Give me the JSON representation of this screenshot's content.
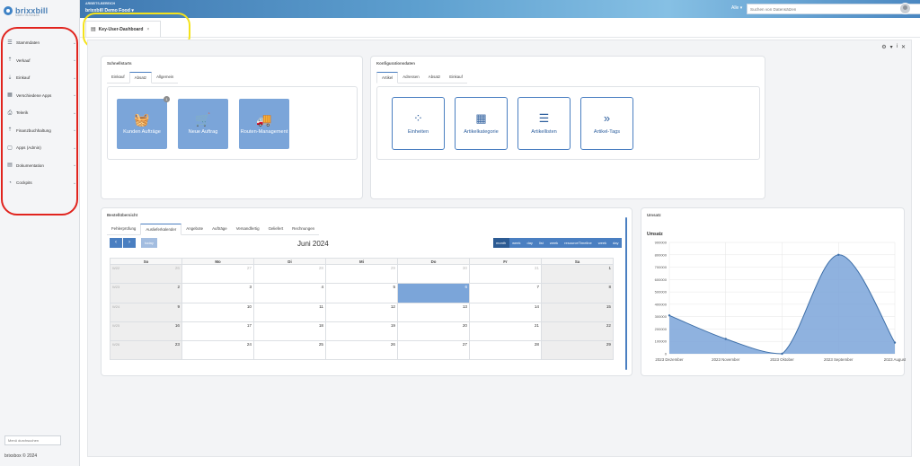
{
  "sidebar": {
    "brand": "brixxbill",
    "brand_sub": "SIMPLY BUSINESS",
    "items": [
      {
        "label": "Stammdaten",
        "icon": "database-icon"
      },
      {
        "label": "Verkauf",
        "icon": "upload-icon"
      },
      {
        "label": "Einkauf",
        "icon": "download-icon"
      },
      {
        "label": "Verschiedene Apps",
        "icon": "apps-icon"
      },
      {
        "label": "Telerik",
        "icon": "print-icon"
      },
      {
        "label": "Finanzbuchhaltung",
        "icon": "finance-icon"
      },
      {
        "label": "Apps (Admin)",
        "icon": "box-icon"
      },
      {
        "label": "Dokumentation",
        "icon": "book-icon"
      },
      {
        "label": "Cockpits",
        "icon": "gauge-icon"
      }
    ],
    "search_placeholder": "Menü durchsuchen",
    "copyright": "brixxbox © 2024"
  },
  "topbar": {
    "company_label": "ARBEITS-BEREICH",
    "company_name": "brixxbill Demo Food",
    "search_scope": "Alle",
    "search_placeholder": "Suchen von Datensätzen"
  },
  "tab": {
    "label": "Key-User-Dashboard",
    "close": "×"
  },
  "schnellstarts": {
    "title": "Schnellstarts",
    "tabs": [
      "Einkauf",
      "Absatz",
      "Allgemein"
    ],
    "active_tab": 1,
    "buttons": [
      {
        "label": "Kunden Aufträge",
        "icon": "basket-icon",
        "badge": "1"
      },
      {
        "label": "Neue Auftrag",
        "icon": "cart-icon"
      },
      {
        "label": "Routen-Management",
        "icon": "truck-icon"
      }
    ]
  },
  "konfiguration": {
    "title": "Konfigurationsdaten",
    "tabs": [
      "Artikel",
      "Adressen",
      "Absatz",
      "Einkauf"
    ],
    "active_tab": 0,
    "buttons": [
      {
        "label": "Einheiten",
        "icon": "dots-grid-icon"
      },
      {
        "label": "Artikelkategorie",
        "icon": "grid-icon"
      },
      {
        "label": "Artikellisten",
        "icon": "list-icon"
      },
      {
        "label": "Artikel-Tags",
        "icon": "double-chevron-icon"
      }
    ]
  },
  "bestell": {
    "title": "Bestellübersicht",
    "tabs": [
      "Fehlerprüfung",
      "Auslieferkalender",
      "Angebote",
      "Aufträge",
      "Versandfertig",
      "Geliefert",
      "Rechnungen"
    ],
    "active_tab": 1,
    "calendar": {
      "title": "Juni 2024",
      "today_label": "today",
      "views": [
        "month",
        "week",
        "day",
        "list",
        "week",
        "resourceTimeline",
        "week",
        "day"
      ],
      "active_view": 0,
      "weekdays": [
        "So",
        "Mo",
        "Di",
        "Mi",
        "Do",
        "Fr",
        "Sa"
      ],
      "weeks": [
        {
          "label": "W22",
          "days": [
            "26",
            "27",
            "28",
            "29",
            "30",
            "31",
            "1"
          ]
        },
        {
          "label": "W23",
          "days": [
            "2",
            "3",
            "4",
            "5",
            "6",
            "7",
            "8"
          ]
        },
        {
          "label": "W24",
          "days": [
            "9",
            "10",
            "11",
            "12",
            "13",
            "14",
            "15"
          ]
        },
        {
          "label": "W25",
          "days": [
            "16",
            "17",
            "18",
            "19",
            "20",
            "21",
            "22"
          ]
        },
        {
          "label": "W26",
          "days": [
            "23",
            "24",
            "25",
            "26",
            "27",
            "28",
            "29"
          ]
        }
      ]
    }
  },
  "umsatz": {
    "title": "Umsatz"
  },
  "chart_data": {
    "type": "area",
    "title": "Umsatz",
    "categories": [
      "2023 Dezember",
      "2023 November",
      "2023 Oktober",
      "2023 September",
      "2023 August"
    ],
    "values": [
      310000,
      120000,
      0,
      800000,
      90000
    ],
    "ylim": [
      0,
      900000
    ],
    "yticks": [
      "0",
      "100000",
      "200000",
      "300000",
      "400000",
      "500000",
      "600000",
      "700000",
      "800000",
      "900000"
    ],
    "color": "#7ba5d9",
    "line_color": "#3e6fa8",
    "grid": true
  }
}
